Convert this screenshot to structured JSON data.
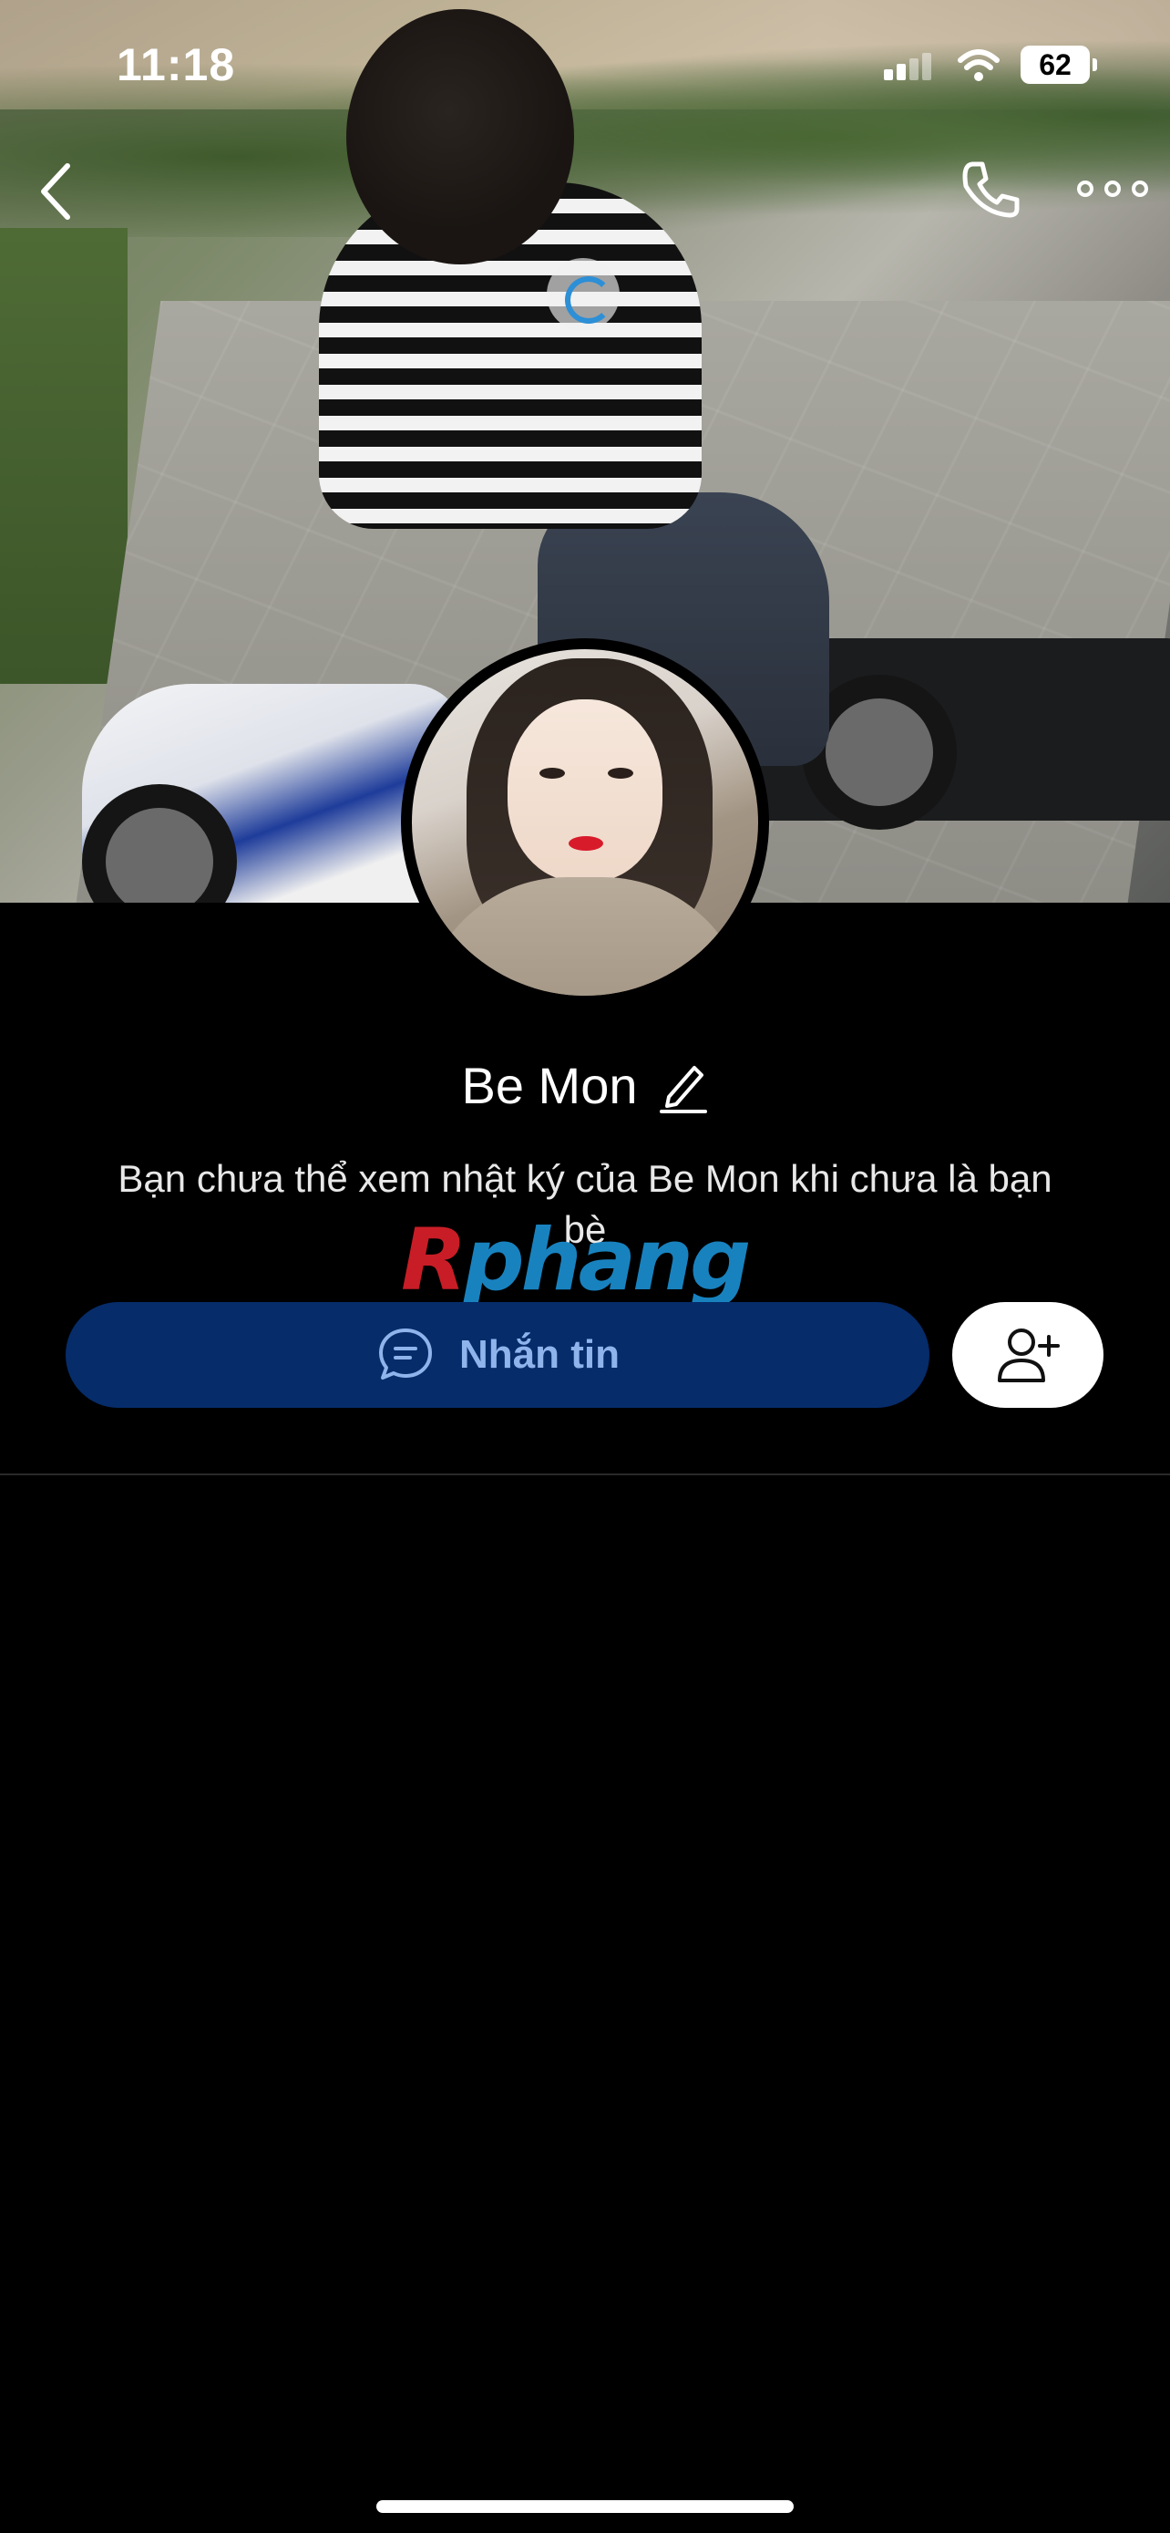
{
  "status_bar": {
    "time": "11:18",
    "battery": "62",
    "signal_icon": "cellular-signal-icon",
    "wifi_icon": "wifi-icon"
  },
  "nav": {
    "back_icon": "chevron-left-icon",
    "call_icon": "phone-icon",
    "more_icon": "more-dots-icon"
  },
  "profile": {
    "name": "Be Mon",
    "edit_icon": "pencil-icon",
    "notice": "Bạn chưa thể xem nhật ký của Be Mon khi chưa là bạn bè"
  },
  "watermark": {
    "first_letter": "R",
    "rest": "phang"
  },
  "actions": {
    "message_label": "Nhắn tin",
    "message_icon": "chat-bubble-icon",
    "add_friend_icon": "add-friend-icon"
  },
  "colors": {
    "background": "#000000",
    "message_button": "#062c6a",
    "message_label": "#8fb4ec",
    "add_button": "#ffffff"
  }
}
